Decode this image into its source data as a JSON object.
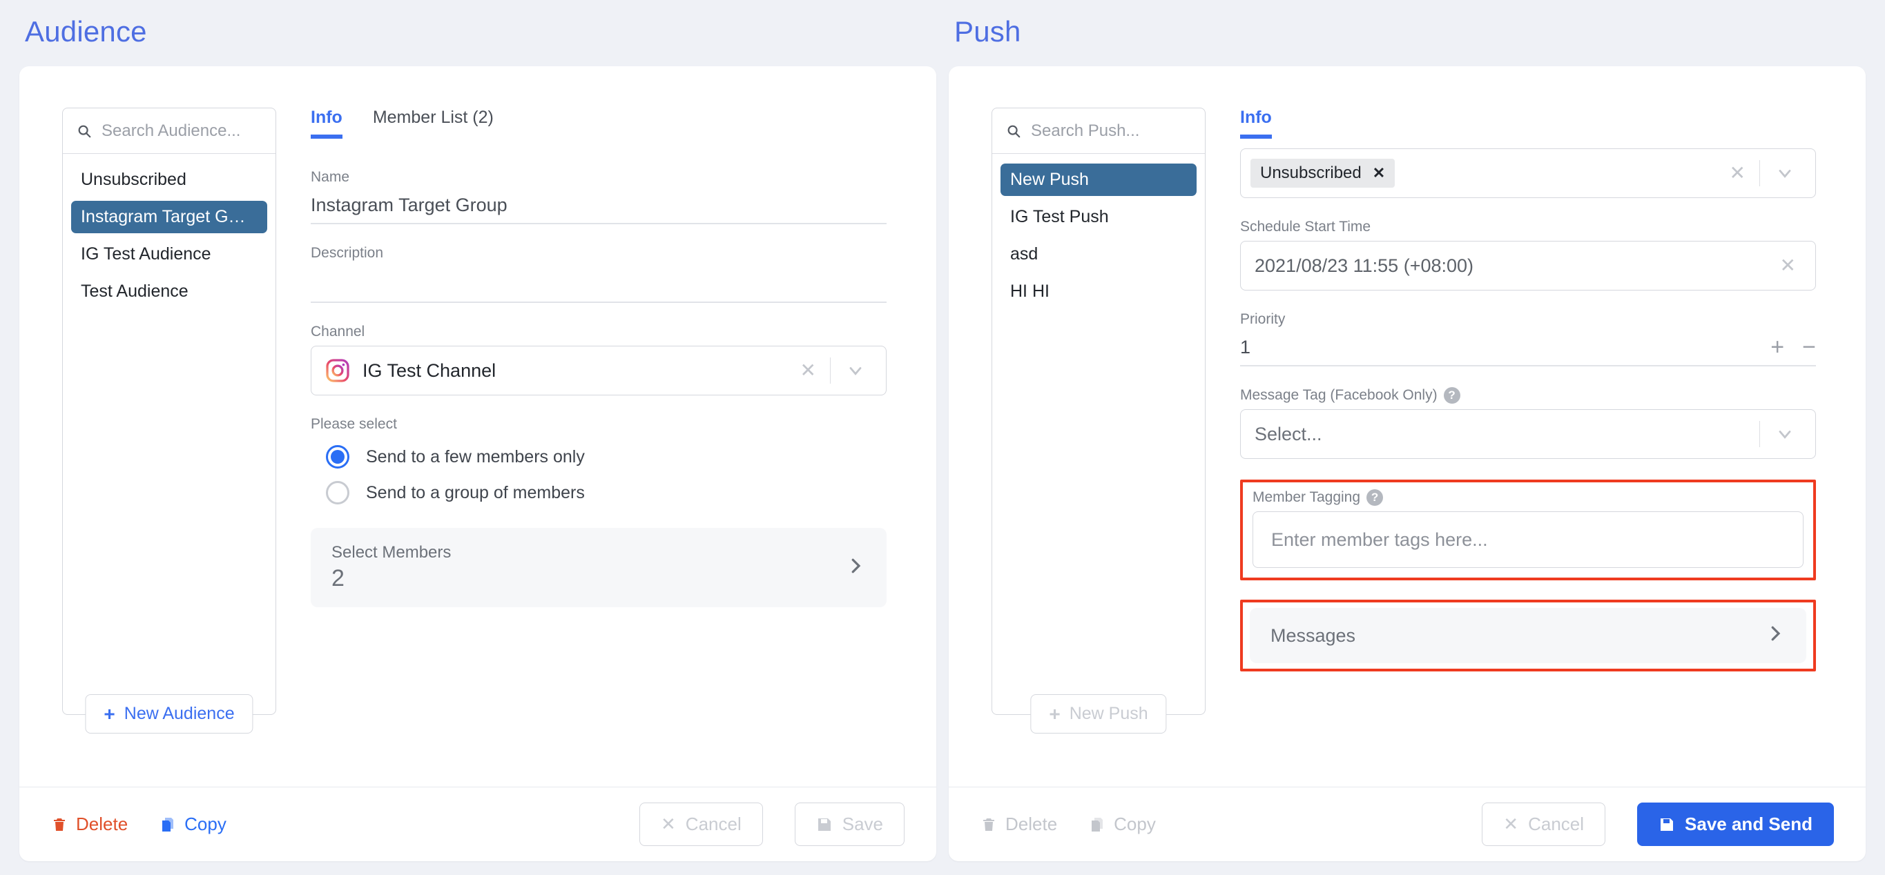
{
  "audience": {
    "title": "Audience",
    "search": {
      "placeholder": "Search Audience...",
      "icon": "search-icon"
    },
    "list": [
      {
        "label": "Unsubscribed",
        "selected": false
      },
      {
        "label": "Instagram Target G…",
        "selected": true
      },
      {
        "label": "IG Test Audience",
        "selected": false
      },
      {
        "label": "Test Audience",
        "selected": false
      }
    ],
    "new_button": "New Audience",
    "tabs": [
      {
        "label": "Info",
        "active": true
      },
      {
        "label": "Member List (2)",
        "active": false
      }
    ],
    "fields": {
      "name_label": "Name",
      "name_value": "Instagram Target Group",
      "description_label": "Description",
      "description_value": "",
      "channel_label": "Channel",
      "channel_value": "IG Test Channel",
      "channel_icon": "instagram-icon",
      "please_select_label": "Please select",
      "radio_options": [
        {
          "label": "Send to a few members only",
          "checked": true
        },
        {
          "label": "Send to a group of members",
          "checked": false
        }
      ],
      "select_members_label": "Select Members",
      "select_members_count": "2"
    },
    "footer": {
      "delete": "Delete",
      "copy": "Copy",
      "cancel": "Cancel",
      "save": "Save"
    }
  },
  "push": {
    "title": "Push",
    "search": {
      "placeholder": "Search Push...",
      "icon": "search-icon"
    },
    "list": [
      {
        "label": "New Push",
        "selected": true
      },
      {
        "label": "IG Test Push",
        "selected": false
      },
      {
        "label": "asd",
        "selected": false
      },
      {
        "label": "HI HI",
        "selected": false
      }
    ],
    "new_button": "New Push",
    "tabs": [
      {
        "label": "Info",
        "active": true
      }
    ],
    "fields": {
      "audience_chip": "Unsubscribed",
      "schedule_label": "Schedule Start Time",
      "schedule_value": "2021/08/23 11:55 (+08:00)",
      "priority_label": "Priority",
      "priority_value": "1",
      "message_tag_label": "Message Tag (Facebook Only)",
      "message_tag_value": "Select...",
      "member_tagging_label": "Member Tagging",
      "member_tagging_placeholder": "Enter member tags here...",
      "messages_label": "Messages"
    },
    "footer": {
      "delete": "Delete",
      "copy": "Copy",
      "cancel": "Cancel",
      "save_and_send": "Save and Send"
    }
  },
  "colors": {
    "accent_blue": "#3b6ff0",
    "selected_item": "#3a6d99",
    "primary_button": "#2a64e8",
    "delete_red": "#e0502a",
    "highlight_red": "#ef3b20",
    "page_background": "#eff1f6"
  }
}
